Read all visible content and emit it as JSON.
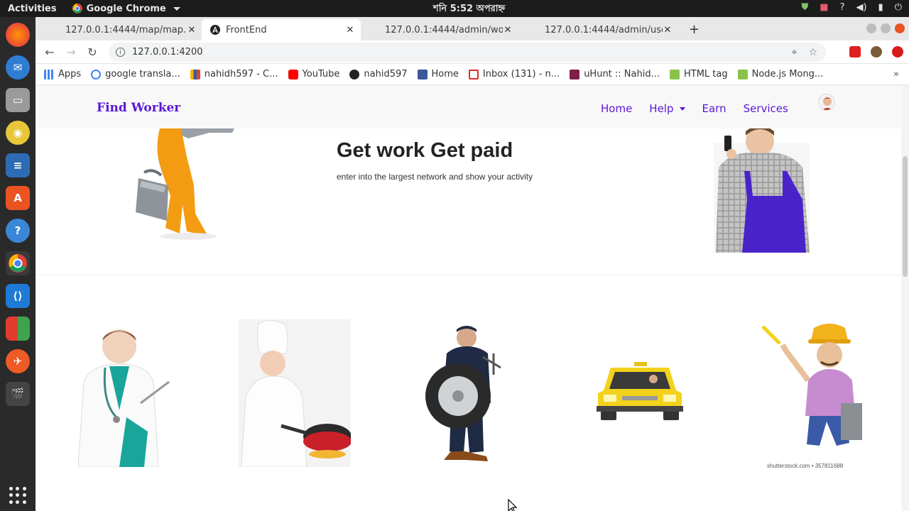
{
  "os_bar": {
    "activities": "Activities",
    "app_name": "Google Chrome",
    "clock": "শনি 5:52 অপরাহ্ন"
  },
  "tabs": [
    {
      "title": "127.0.0.1:4444/map/map...",
      "active": false
    },
    {
      "title": "FrontEnd",
      "active": true
    },
    {
      "title": "127.0.0.1:4444/admin/wo...",
      "active": false
    },
    {
      "title": "127.0.0.1:4444/admin/use...",
      "active": false
    }
  ],
  "address_bar": {
    "url": "127.0.0.1:4200"
  },
  "bookmarks": [
    {
      "label": "Apps",
      "icon": "apps-grid-icon",
      "color": "#4285f4"
    },
    {
      "label": "google transla...",
      "icon": "google-icon",
      "color": "#4285f4"
    },
    {
      "label": "nahidh597 - C...",
      "icon": "chart-icon",
      "color": "#f4b400"
    },
    {
      "label": "YouTube",
      "icon": "youtube-icon",
      "color": "#ff0000"
    },
    {
      "label": "nahid597",
      "icon": "github-icon",
      "color": "#222222"
    },
    {
      "label": "Home",
      "icon": "facebook-icon",
      "color": "#3b5998"
    },
    {
      "label": "Inbox (131) - n...",
      "icon": "gmail-icon",
      "color": "#d93025"
    },
    {
      "label": "uHunt :: Nahid...",
      "icon": "uhunt-icon",
      "color": "#7d1f49"
    },
    {
      "label": "HTML tag",
      "icon": "html-icon",
      "color": "#8bc34a"
    },
    {
      "label": "Node.js Mong...",
      "icon": "nodejs-icon",
      "color": "#8bc34a"
    }
  ],
  "site": {
    "brand": "Find Worker",
    "nav": [
      {
        "label": "Home"
      },
      {
        "label": "Help"
      },
      {
        "label": "Earn"
      },
      {
        "label": "Services"
      }
    ],
    "hero_title": "Get work Get paid",
    "hero_subtitle": "enter into the largest network and show your activity",
    "workers": [
      "doctor",
      "chef",
      "mechanic",
      "taxi-driver",
      "handyman"
    ],
    "image_credit": "shutterstock.com • 357811688"
  },
  "colors": {
    "brand": "#5a17d6",
    "nav_bg": "#f8f8f8"
  }
}
